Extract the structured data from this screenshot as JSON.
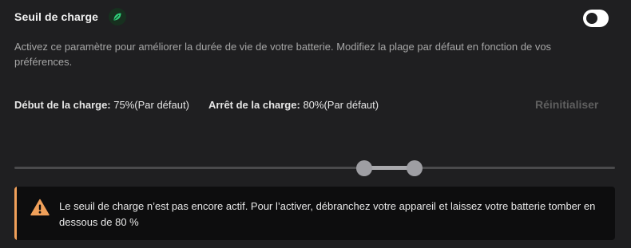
{
  "charge_threshold": {
    "title": "Seuil de charge",
    "leaf_icon": "leaf-icon",
    "toggle_enabled": false,
    "description": "Activez ce paramètre pour améliorer la durée de vie de votre batterie. Modifiez la plage par défaut en fonction de vos préférences.",
    "start": {
      "label": "Début de la charge:",
      "value": "75%(Par défaut)",
      "percent": 75
    },
    "stop": {
      "label": "Arrêt de la charge:",
      "value": "80%(Par défaut)",
      "percent": 80
    },
    "reset_label": "Réinitialiser",
    "colors": {
      "accent_green": "#2fd07a",
      "warning_orange": "#f0a05a",
      "toggle_on_track": "#ffffff"
    }
  },
  "warning": {
    "icon": "warning-triangle-icon",
    "text": "Le seuil de charge n’est pas encore actif. Pour l’activer, débranchez votre appareil et laissez votre batterie tomber en dessous de 80 %"
  }
}
